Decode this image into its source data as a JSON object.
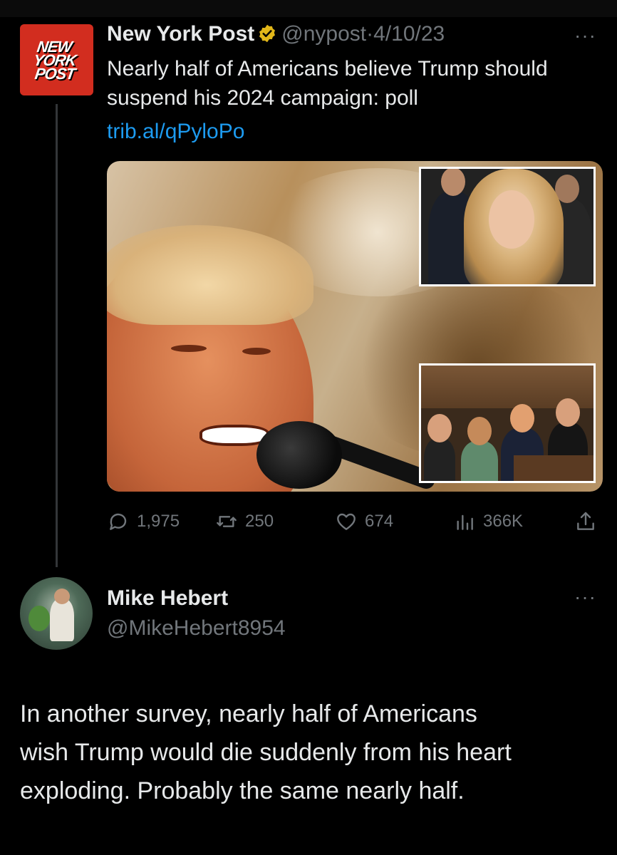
{
  "original_tweet": {
    "logo_lines": [
      "NEW",
      "YORK",
      "POST"
    ],
    "author_name": "New York Post",
    "handle": "@nypost",
    "separator": "·",
    "date": "4/10/23",
    "more_glyph": "···",
    "text": "Nearly half of Americans believe Trump should suspend his 2024 campaign: poll",
    "link": "trib.al/qPyloPo",
    "stats": {
      "replies": "1,975",
      "retweets": "250",
      "likes": "674",
      "views": "366K"
    }
  },
  "reply_tweet": {
    "author_name": "Mike Hebert",
    "handle": "@MikeHebert8954",
    "more_glyph": "···",
    "text": "In another survey, nearly half of Americans\nwish Trump would die suddenly from his heart\nexploding.  Probably the same nearly half."
  },
  "colors": {
    "background": "#000000",
    "text": "#e7e9ea",
    "muted": "#71767b",
    "link": "#1d9bf0",
    "brand_red": "#d22d1f",
    "verified_gold": "#e2b719"
  },
  "icons": [
    "verified-badge-icon",
    "reply-icon",
    "retweet-icon",
    "like-icon",
    "views-icon",
    "share-icon",
    "more-icon"
  ]
}
